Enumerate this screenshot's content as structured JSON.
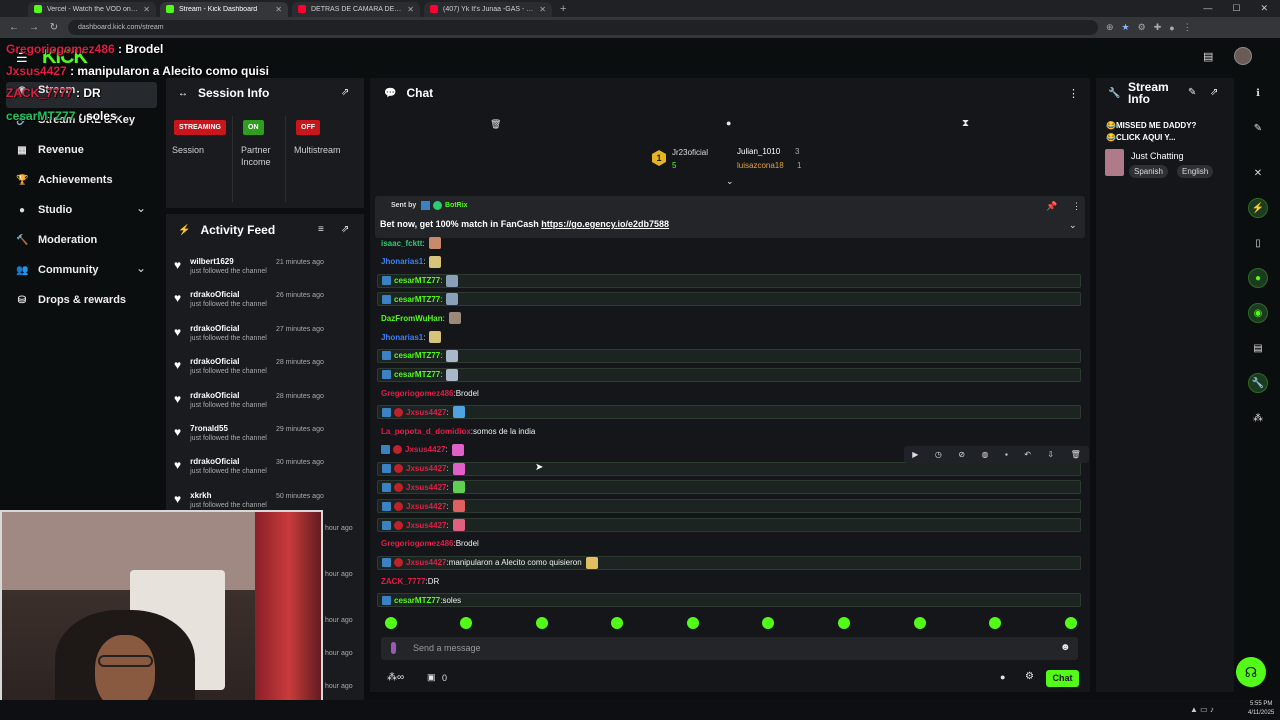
{
  "browser": {
    "tabs": [
      {
        "label": "Vercel - Watch the VOD on Ki",
        "color": "#53fc18",
        "active": false
      },
      {
        "label": "Stream - Kick Dashboard",
        "color": "#53fc18",
        "active": true
      },
      {
        "label": "DETRAS DE CAMARA DE MIS RO",
        "color": "#ff0033",
        "active": false
      },
      {
        "label": "(407) Yk It's Junaa -GAS - Video G",
        "color": "#ff0033",
        "active": false
      }
    ],
    "new_tab": "+",
    "url": "dashboard.kick.com/stream"
  },
  "overlay_chat": [
    {
      "name": "Gregoriogomez486",
      "sep": " : ",
      "text": "Brodel",
      "color": "red"
    },
    {
      "name": "Jxsus4427",
      "sep": " : ",
      "text": "manipularon a Alecito como quisi",
      "color": "red"
    },
    {
      "name": "ZACK_7777",
      "sep": " : ",
      "text": "DR",
      "color": "red"
    },
    {
      "name": "cesarMTZ77",
      "sep": " : ",
      "text": "soles",
      "color": "green"
    }
  ],
  "sidebar": {
    "items": [
      {
        "label": "Stream",
        "icon": "stream-icon"
      },
      {
        "label": "Stream URL & Key",
        "icon": "link-icon"
      },
      {
        "label": "Revenue",
        "icon": "revenue-icon"
      },
      {
        "label": "Achievements",
        "icon": "trophy-icon"
      },
      {
        "label": "Studio",
        "icon": "studio-icon",
        "expand": "⌄"
      },
      {
        "label": "Moderation",
        "icon": "hammer-icon"
      },
      {
        "label": "Community",
        "icon": "community-icon",
        "expand": "⌄"
      },
      {
        "label": "Drops & rewards",
        "icon": "gift-icon"
      }
    ]
  },
  "session_info": {
    "title": "Session Info",
    "stats": [
      {
        "badge": "STREAMING",
        "badge_color": "#c8161d",
        "label": "Session"
      },
      {
        "badge": "ON",
        "badge_color": "#2f9e1e",
        "label": "Partner Income"
      },
      {
        "badge": "OFF",
        "badge_color": "#c8161d",
        "label": "Multistream"
      }
    ]
  },
  "activity_feed": {
    "title": "Activity Feed",
    "items": [
      {
        "user": "wilbert1629",
        "action": "just followed the channel",
        "time": "21 minutes ago"
      },
      {
        "user": "rdrakoOficial",
        "action": "just followed the channel",
        "time": "26 minutes ago"
      },
      {
        "user": "rdrakoOficial",
        "action": "just followed the channel",
        "time": "27 minutes ago"
      },
      {
        "user": "rdrakoOficial",
        "action": "just followed the channel",
        "time": "28 minutes ago"
      },
      {
        "user": "rdrakoOficial",
        "action": "just followed the channel",
        "time": "28 minutes ago"
      },
      {
        "user": "7ronald55",
        "action": "just followed the channel",
        "time": "29 minutes ago"
      },
      {
        "user": "rdrakoOficial",
        "action": "just followed the channel",
        "time": "30 minutes ago"
      },
      {
        "user": "xkrkh",
        "action": "just followed the channel",
        "time": "50 minutes ago"
      }
    ],
    "hidden_times": [
      "hour ago",
      "hour ago",
      "hour ago",
      "hour ago",
      "hour ago"
    ]
  },
  "chat": {
    "title": "Chat",
    "leaderboard": {
      "first": {
        "rank": "1",
        "name": "Jr23oficial",
        "count": "5"
      },
      "second": {
        "name": "Julian_1010",
        "count": "3"
      },
      "third": {
        "name": "luisazcona18",
        "count": "1"
      }
    },
    "pinned": {
      "sent_by_label": "Sent by",
      "sender": "BotRix",
      "text": "Bet now, get 100% match in FanCash ",
      "link": "https://go.egency.io/e2db7588"
    },
    "messages": [
      {
        "name": "isaac_fcktt",
        "color": "#2ecc71",
        "text": "",
        "badges": 0,
        "hl": false,
        "emote": "#c98a6b"
      },
      {
        "name": "Jhonarias1",
        "color": "#3b82f6",
        "text": "",
        "badges": 0,
        "hl": false,
        "emote": "#d8c37a"
      },
      {
        "name": "cesarMTZ77",
        "color": "#53fc18",
        "text": "",
        "badges": 1,
        "hl": true,
        "emote": "#8aa0b8"
      },
      {
        "name": "cesarMTZ77",
        "color": "#53fc18",
        "text": "",
        "badges": 1,
        "hl": true,
        "emote": "#8aa0b8"
      },
      {
        "name": "DazFromWuHan",
        "color": "#53fc18",
        "text": "",
        "badges": 0,
        "hl": false,
        "emote": "#9b8a7a"
      },
      {
        "name": "Jhonarias1",
        "color": "#3b82f6",
        "text": "",
        "badges": 0,
        "hl": false,
        "emote": "#d8c37a"
      },
      {
        "name": "cesarMTZ77",
        "color": "#53fc18",
        "text": "",
        "badges": 1,
        "hl": true,
        "emote": "#a9b8c8"
      },
      {
        "name": "cesarMTZ77",
        "color": "#53fc18",
        "text": "",
        "badges": 1,
        "hl": true,
        "emote": "#a9b8c8"
      },
      {
        "name": "Gregoriogomez486",
        "color": "#e11d48",
        "text": "Brodel",
        "badges": 0,
        "hl": false,
        "emote": ""
      },
      {
        "name": "Jxsus4427",
        "color": "#e11d48",
        "text": "",
        "badges": 2,
        "hl": true,
        "emote": "#4fa3e0"
      },
      {
        "name": "La_popota_d_domidiox",
        "color": "#e11d48",
        "text": "somos de la india",
        "badges": 0,
        "hl": false,
        "emote": ""
      },
      {
        "name": "Jxsus4427",
        "color": "#e11d48",
        "text": "",
        "badges": 2,
        "hl": false,
        "emote": "#e05fc8"
      },
      {
        "name": "Jxsus4427",
        "color": "#e11d48",
        "text": "",
        "badges": 2,
        "hl": true,
        "emote": "#e05fc8"
      },
      {
        "name": "Jxsus4427",
        "color": "#e11d48",
        "text": "",
        "badges": 2,
        "hl": true,
        "emote": "#5fd04f"
      },
      {
        "name": "Jxsus4427",
        "color": "#e11d48",
        "text": "",
        "badges": 2,
        "hl": true,
        "emote": "#e06060"
      },
      {
        "name": "Jxsus4427",
        "color": "#e11d48",
        "text": "",
        "badges": 2,
        "hl": true,
        "emote": "#e06080"
      },
      {
        "name": "Gregoriogomez486",
        "color": "#e11d48",
        "text": "Brodel",
        "badges": 0,
        "hl": false,
        "emote": ""
      },
      {
        "name": "Jxsus4427",
        "color": "#e11d48",
        "text": "manipularon a Alecito como quisieron",
        "badges": 2,
        "hl": true,
        "emote": "#e0c060"
      },
      {
        "name": "ZACK_7777",
        "color": "#e11d48",
        "text": "DR",
        "badges": 0,
        "hl": false,
        "emote": ""
      },
      {
        "name": "cesarMTZ77",
        "color": "#53fc18",
        "text": "soles",
        "badges": 1,
        "hl": true,
        "emote": ""
      }
    ],
    "input_placeholder": "Send a message",
    "footer_count": "0",
    "send_button": "Chat"
  },
  "stream_info": {
    "title": "Stream Info",
    "stream_title_line1": "😂MISSED ME DADDY?",
    "stream_title_line2": "😂CLICK AQUI Y...",
    "category": "Just Chatting",
    "tags": [
      "Spanish",
      "English"
    ]
  },
  "taskbar": {
    "time": "5:55 PM",
    "date": "4/11/2025"
  }
}
